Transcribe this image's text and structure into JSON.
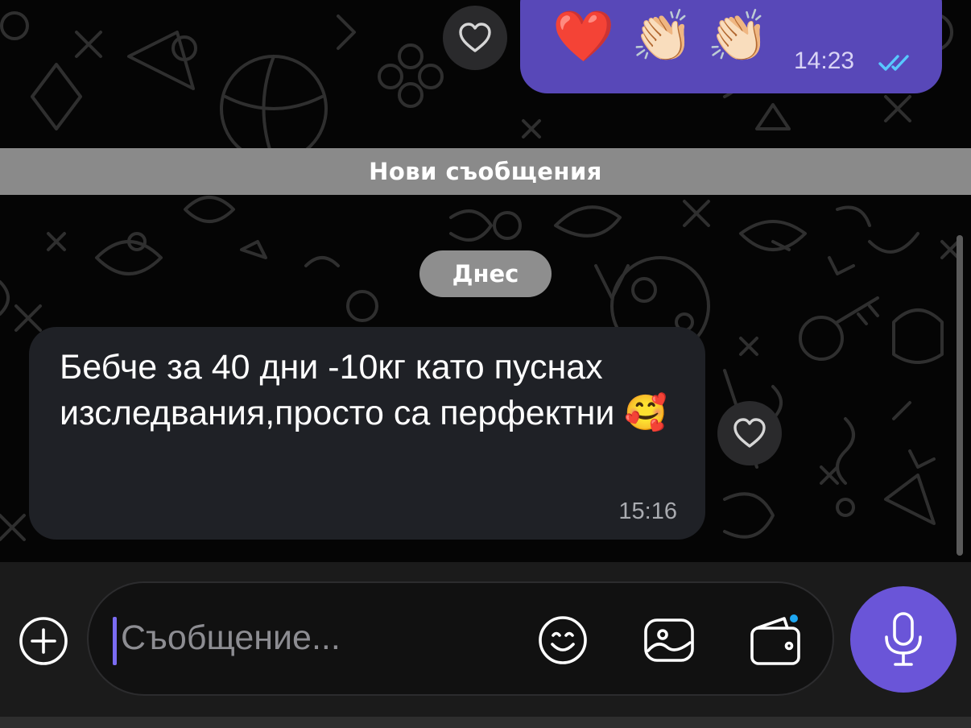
{
  "outgoing_message": {
    "emojis": [
      "❤️",
      "👏🏻",
      "👏🏻"
    ],
    "time": "14:23",
    "status_icon": "double-check-read-icon"
  },
  "new_messages_label": "Нови съобщения",
  "date_label": "Днес",
  "incoming_message": {
    "text": "Бебче за 40 дни -10кг като пуснах изследвания,просто са перфектни 🥰",
    "time": "15:16"
  },
  "composer": {
    "placeholder": "Съобщение...",
    "icons": [
      "plus-icon",
      "emoji-icon",
      "gallery-icon",
      "wallet-icon",
      "microphone-icon"
    ]
  },
  "colors": {
    "accent": "#6a55d8",
    "outgoing_bubble": "#5848b8",
    "incoming_bubble": "#1f2126",
    "notification_dot": "#1ea7f2"
  }
}
